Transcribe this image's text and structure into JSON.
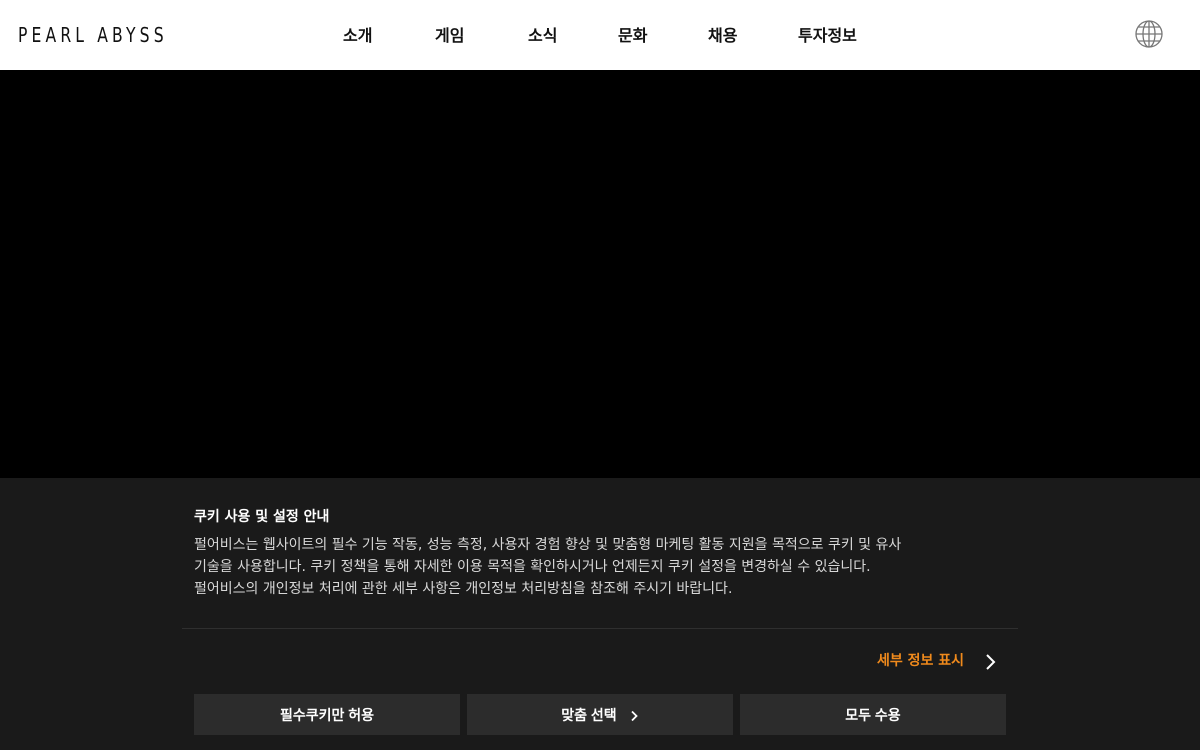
{
  "header": {
    "logo_text": "PEARL ABYSS",
    "nav": [
      {
        "label": "소개"
      },
      {
        "label": "게임"
      },
      {
        "label": "소식"
      },
      {
        "label": "문화"
      },
      {
        "label": "채용"
      },
      {
        "label": "투자정보"
      }
    ],
    "language_icon": "globe-icon"
  },
  "cookie_banner": {
    "title": "쿠키 사용 및 설정 안내",
    "body_lines": [
      "펄어비스는 웹사이트의 필수 기능 작동, 성능 측정, 사용자 경험 향상 및 맞춤형 마케팅 활동 지원을 목적으로 쿠키 및 유사",
      "기술을 사용합니다. 쿠키 정책을 통해 자세한 이용 목적을 확인하시거나 언제든지 쿠키 설정을 변경하실 수 있습니다.",
      "펄어비스의 개인정보 처리에 관한 세부 사항은 개인정보 처리방침을 참조해 주시기 바랍니다."
    ],
    "detail_link": "세부 정보 표시",
    "buttons": {
      "essential_only": "필수쿠키만 허용",
      "custom": "맞춤 선택",
      "accept_all": "모두 수용"
    },
    "accent_color": "#f08a1c"
  }
}
